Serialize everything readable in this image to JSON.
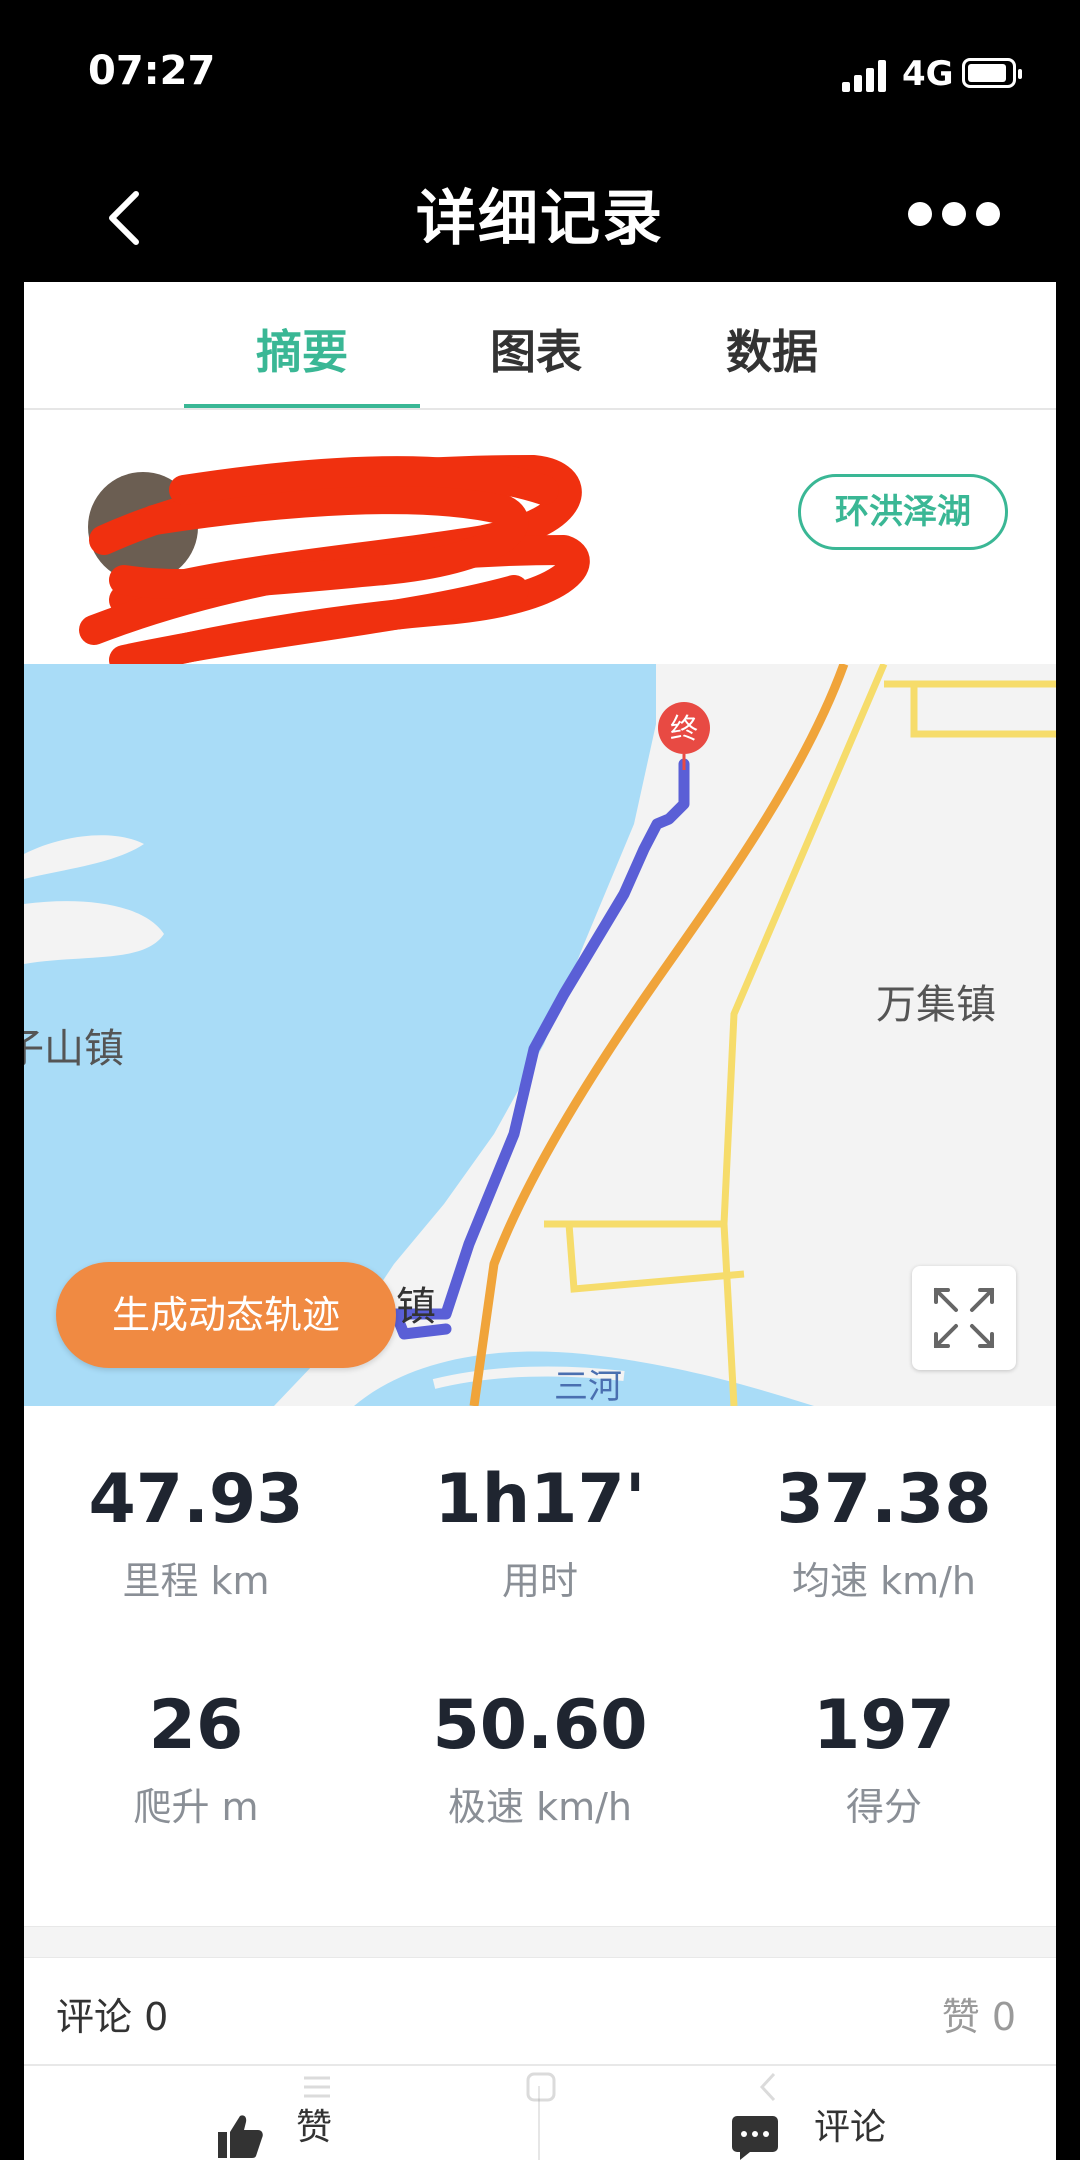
{
  "status_bar": {
    "time": "07:27",
    "network": "4G"
  },
  "nav": {
    "title": "详细记录"
  },
  "tabs": [
    {
      "label": "摘要"
    },
    {
      "label": "图表"
    },
    {
      "label": "数据"
    }
  ],
  "profile": {
    "route_badge": "环洪泽湖"
  },
  "map": {
    "places": [
      "万集镇",
      "子山镇",
      "镇",
      "三河"
    ],
    "end_marker": "终",
    "generate_track_button": "生成动态轨迹"
  },
  "stats": [
    {
      "value": "47.93",
      "label": "里程 km"
    },
    {
      "value": "1h17'",
      "label": "用时"
    },
    {
      "value": "37.38",
      "label": "均速 km/h"
    },
    {
      "value": "26",
      "label": "爬升 m"
    },
    {
      "value": "50.60",
      "label": "极速 km/h"
    },
    {
      "value": "197",
      "label": "得分"
    }
  ],
  "social": {
    "comments": "评论 0",
    "likes": "赞 0"
  },
  "actions": {
    "like_label": "赞",
    "comment_label": "评论"
  },
  "colors": {
    "accent": "#3ab795",
    "route": "#5a5fd6",
    "button": "#f08a42",
    "water": "#a9dcf7"
  }
}
